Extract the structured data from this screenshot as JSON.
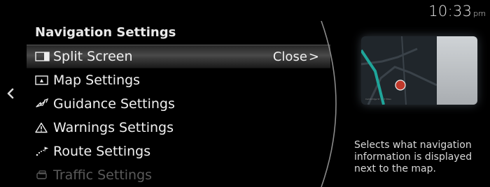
{
  "status_bar": {
    "time": "10:33",
    "ampm": "pm"
  },
  "menu": {
    "title": "Navigation Settings",
    "items": [
      {
        "label": "Split Screen",
        "value": "Close",
        "value_suffix": ">",
        "icon": "split-screen-icon",
        "selected": true
      },
      {
        "label": "Map Settings",
        "icon": "map-icon",
        "selected": false
      },
      {
        "label": "Guidance Settings",
        "icon": "guidance-icon",
        "selected": false
      },
      {
        "label": "Warnings Settings",
        "icon": "warning-icon",
        "selected": false
      },
      {
        "label": "Route Settings",
        "icon": "route-icon",
        "selected": false
      },
      {
        "label": "Traffic Settings",
        "icon": "traffic-icon",
        "selected": false,
        "faded": true
      }
    ]
  },
  "preview": {
    "caption": "Cambridge St  ·  0.3 Miles"
  },
  "description": "Selects what navigation information is displayed next to the map.",
  "colors": {
    "background": "#000000",
    "text": "#f0f0f0",
    "faded_text": "#5a5a5a",
    "route_teal": "#1fa59a",
    "marker_red": "#c0392b"
  }
}
